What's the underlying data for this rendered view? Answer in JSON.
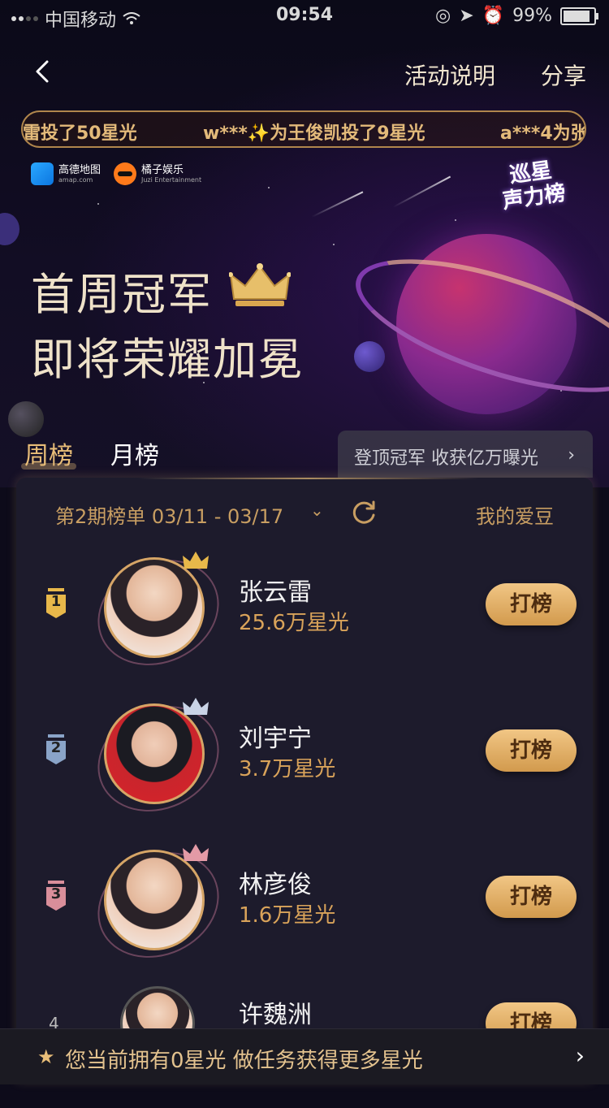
{
  "status_bar": {
    "carrier": "中国移动",
    "time": "09:54",
    "battery": "99%"
  },
  "nav": {
    "rules_label": "活动说明",
    "share_label": "分享"
  },
  "ticker": [
    "雷投了50星光",
    "w***✨为王俊凯投了9星光",
    "a***4为张"
  ],
  "sponsors": [
    {
      "name": "高德地图",
      "sub": "amap.com"
    },
    {
      "name": "橘子娱乐",
      "sub": "Juzi Entertainment"
    }
  ],
  "event_logo": {
    "line1": "巡星",
    "line2": "声力榜"
  },
  "headline": {
    "line1": "首周冠军",
    "line2": "即将荣耀加冕"
  },
  "tabs": {
    "week": "周榜",
    "month": "月榜"
  },
  "promo": {
    "label": "登顶冠军 收获亿万曝光"
  },
  "period": {
    "label": "第2期榜单 03/11 - 03/17",
    "my_idol": "我的爱豆"
  },
  "ranking": [
    {
      "rank": "1",
      "name": "张云雷",
      "score": "25.6万星光",
      "button": "打榜"
    },
    {
      "rank": "2",
      "name": "刘宇宁",
      "score": "3.7万星光",
      "button": "打榜"
    },
    {
      "rank": "3",
      "name": "林彦俊",
      "score": "1.6万星光",
      "button": "打榜"
    },
    {
      "rank": "4",
      "name": "许魏洲",
      "score": "",
      "button": "打榜"
    }
  ],
  "bottom_bar": {
    "text": "您当前拥有0星光 做任务获得更多星光"
  },
  "colors": {
    "gold": "#e8bd78",
    "rank1": "#e8b84a",
    "rank2": "#8aa4c8",
    "rank3": "#d98e9a"
  }
}
